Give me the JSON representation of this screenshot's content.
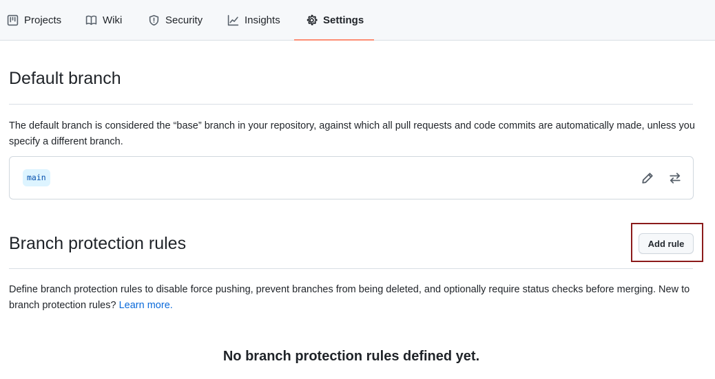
{
  "tabs": [
    {
      "label": "Projects",
      "icon": "project-board-icon"
    },
    {
      "label": "Wiki",
      "icon": "book-icon"
    },
    {
      "label": "Security",
      "icon": "shield-icon"
    },
    {
      "label": "Insights",
      "icon": "graph-icon"
    },
    {
      "label": "Settings",
      "icon": "gear-icon",
      "selected": true
    }
  ],
  "default_branch": {
    "title": "Default branch",
    "description": "The default branch is considered the “base” branch in your repository, against which all pull requests and code commits are automatically made, unless you specify a different branch.",
    "branch_name": "main",
    "edit_icon": "pencil-icon",
    "switch_icon": "arrow-switch-icon"
  },
  "protection": {
    "title": "Branch protection rules",
    "add_rule_label": "Add rule",
    "description": "Define branch protection rules to disable force pushing, prevent branches from being deleted, and optionally require status checks before merging. New to branch protection rules?",
    "learn_more": "Learn more.",
    "empty_title": "No branch protection rules defined yet."
  },
  "colors": {
    "accent_underline": "#fd8c73",
    "highlight_border": "#8b1a1a",
    "link": "#0969da",
    "branch_chip_bg": "#ddf4ff"
  }
}
